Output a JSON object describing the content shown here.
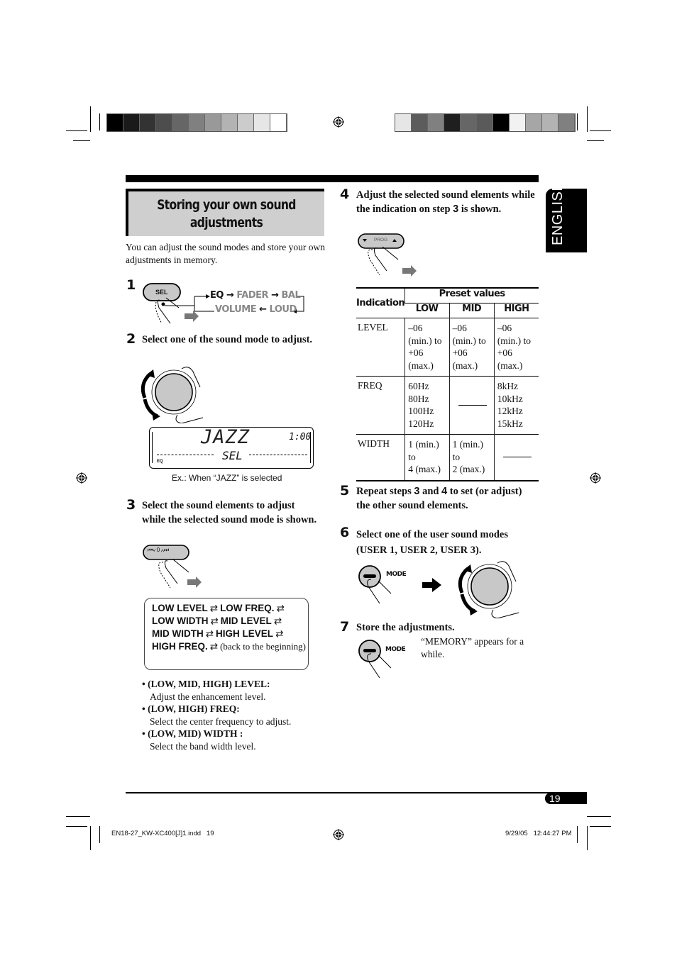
{
  "color_bars": {
    "left": [
      "#000000",
      "#1a1a1a",
      "#333333",
      "#4d4d4d",
      "#666666",
      "#808080",
      "#999999",
      "#b3b3b3",
      "#cccccc",
      "#e6e6e6",
      "#ffffff"
    ],
    "right": [
      "#e6e6e6",
      "#5c5c5c",
      "#808080",
      "#1f1f1f",
      "#666666",
      "#5a5a5a",
      "#000000",
      "#f2f2f2",
      "#a6a6a6",
      "#b3b3b3",
      "#808080"
    ]
  },
  "side_tab": {
    "label": "ENGLISH"
  },
  "section": {
    "title_line1": "Storing your own sound",
    "title_line2": "adjustments",
    "intro": "You can adjust the sound modes and store your own adjustments in memory."
  },
  "step1": {
    "number": "1",
    "button_label": "SEL",
    "flow_top": [
      "EQ",
      "FADER",
      "BAL"
    ],
    "flow_bottom": [
      "VOLUME",
      "LOUD"
    ]
  },
  "step2": {
    "number": "2",
    "text": "Select one of the sound mode to adjust.",
    "display": {
      "main": "JAZZ",
      "clock": "1:00",
      "sub": "SEL",
      "indicator": "EQ"
    },
    "caption": "Ex.: When “JAZZ” is selected"
  },
  "step3": {
    "number": "3",
    "text": "Select the sound elements to adjust while the selected sound mode is shown.",
    "button_label": "⏮∨ 0 ∧⏭",
    "sequence": [
      {
        "items": [
          "LOW LEVEL",
          "LOW FREQ."
        ]
      },
      {
        "items": [
          "LOW WIDTH",
          "MID LEVEL"
        ]
      },
      {
        "items": [
          "MID WIDTH",
          "HIGH LEVEL"
        ]
      },
      {
        "items": [
          "HIGH FREQ."
        ]
      }
    ],
    "sequence_end": "(back to the beginning)",
    "arrow_glyph": "⇄",
    "bullets": [
      {
        "head": "(LOW, MID, HIGH) LEVEL:",
        "desc": "Adjust the enhancement level."
      },
      {
        "head": "(LOW, HIGH) FREQ:",
        "desc": "Select the center frequency to adjust."
      },
      {
        "head": "(LOW, MID) WIDTH :",
        "desc": "Select the band width level."
      }
    ]
  },
  "step4": {
    "number": "4",
    "text_pre": "Adjust the selected sound elements while the indication on step ",
    "text_ref": "3",
    "text_post": " is shown.",
    "button_label": "PROG",
    "table": {
      "header_indication": "Indication",
      "header_preset": "Preset values",
      "columns": [
        "LOW",
        "MID",
        "HIGH"
      ],
      "rows": [
        {
          "label": "LEVEL",
          "low": [
            "–06",
            "(min.) to",
            "+06",
            "(max.)"
          ],
          "mid": [
            "–06",
            "(min.) to",
            "+06",
            "(max.)"
          ],
          "high": [
            "–06",
            "(min.) to",
            "+06",
            "(max.)"
          ]
        },
        {
          "label": "FREQ",
          "low": [
            "60Hz",
            "80Hz",
            "100Hz",
            "120Hz"
          ],
          "mid": [],
          "high": [
            "8kHz",
            "10kHz",
            "12kHz",
            "15kHz"
          ]
        },
        {
          "label": "WIDTH",
          "low": [
            "1 (min.)",
            "to",
            "4 (max.)"
          ],
          "mid": [
            "1 (min.)",
            "to",
            "2 (max.)"
          ],
          "high": []
        }
      ]
    }
  },
  "step5": {
    "number": "5",
    "t1": "Repeat steps ",
    "r1": "3",
    "t2": " and ",
    "r2": "4",
    "t3": " to set (or adjust) the other sound elements."
  },
  "step6": {
    "number": "6",
    "text": "Select one of the user sound modes (USER 1, USER 2, USER 3).",
    "button_label": "MODE"
  },
  "step7": {
    "number": "7",
    "text": "Store the adjustments.",
    "button_label": "MODE",
    "note": "“MEMORY” appears for a while."
  },
  "footer": {
    "page_number": "19",
    "slug_left": "EN18-27_KW-XC400[J]1.indd   19",
    "slug_right": "9/29/05   12:44:27 PM"
  }
}
